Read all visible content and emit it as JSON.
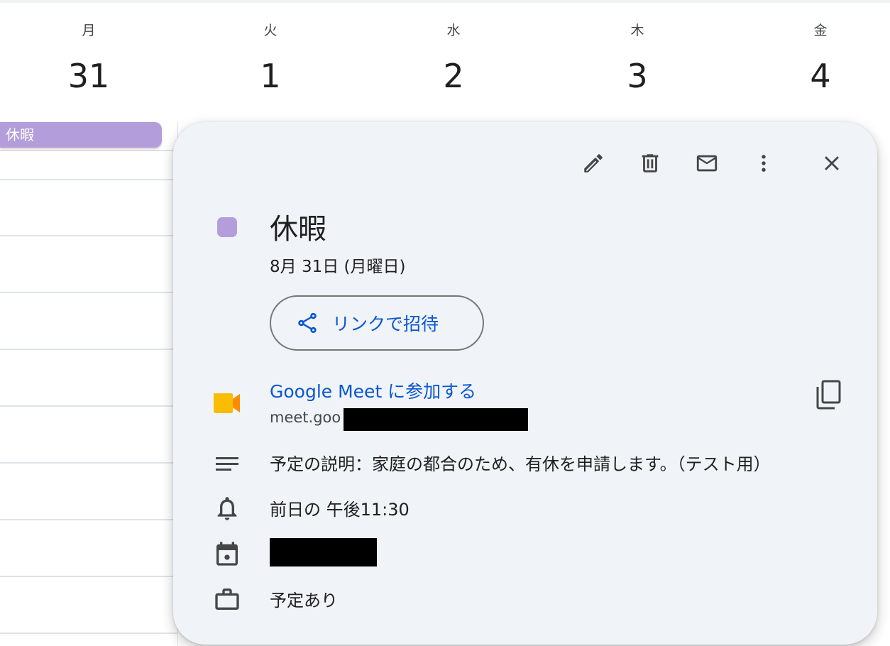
{
  "week_header": {
    "days": [
      {
        "dow": "月",
        "date": "31"
      },
      {
        "dow": "火",
        "date": "1"
      },
      {
        "dow": "水",
        "date": "2"
      },
      {
        "dow": "木",
        "date": "3"
      },
      {
        "dow": "金",
        "date": "4"
      }
    ]
  },
  "allday_event": {
    "label": "休暇",
    "color": "#b39ddb"
  },
  "popup": {
    "toolbar": {
      "edit_icon": "pencil-icon",
      "delete_icon": "trash-icon",
      "email_icon": "mail-icon",
      "more_icon": "more-vert-icon",
      "close_icon": "close-icon"
    },
    "event_color": "#b39ddb",
    "title": "休暇",
    "date": "8月 31日 (月曜日)",
    "invite_button": {
      "label": "リンクで招待",
      "icon": "share-icon"
    },
    "meet": {
      "link_text": "Google Meet に参加する",
      "url_prefix": "meet.goo",
      "icon": "google-meet-icon",
      "copy_icon": "copy-icon"
    },
    "description": "予定の説明：家庭の都合のため、有休を申請します。（テスト用）",
    "reminder": "前日の 午後11:30",
    "calendar_icon": "calendar-icon",
    "availability": "予定あり"
  },
  "colors": {
    "accent": "#0b57d0",
    "popup_bg": "#f0f4f9"
  }
}
